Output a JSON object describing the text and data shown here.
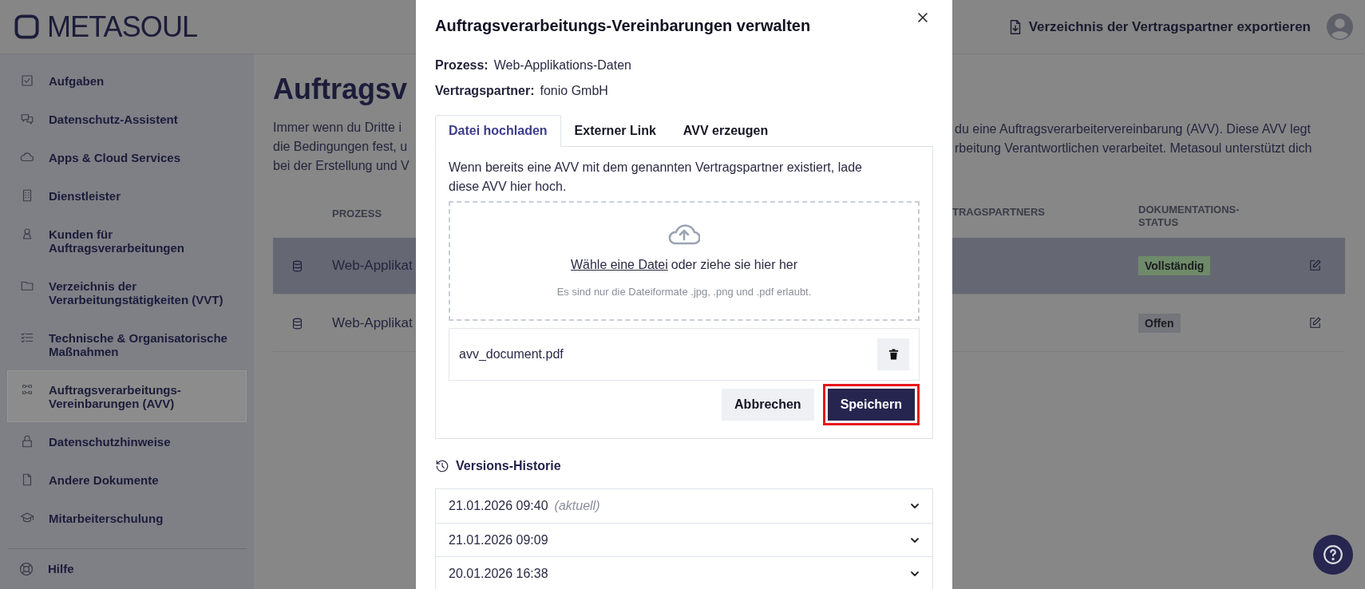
{
  "header": {
    "logo": "METASOUL",
    "export_button": "Verzeichnis der Vertragspartner exportieren"
  },
  "sidebar": {
    "items": [
      {
        "label": "Aufgaben",
        "selected": false
      },
      {
        "label": "Datenschutz-Assistent",
        "selected": false
      },
      {
        "label": "Apps & Cloud Services",
        "selected": false
      },
      {
        "label": "Dienstleister",
        "selected": false
      },
      {
        "label": "Kunden für Auftragsverarbeitungen",
        "selected": false
      },
      {
        "label": "Verzeichnis der Verarbeitungstätigkeiten (VVT)",
        "selected": false
      },
      {
        "label": "Technische & Organisatorische Maßnahmen",
        "selected": false
      },
      {
        "label": "Auftragsverarbeitungs-Vereinbarungen (AVV)",
        "selected": true
      },
      {
        "label": "Datenschutzhinweise",
        "selected": false
      },
      {
        "label": "Andere Dokumente",
        "selected": false
      },
      {
        "label": "Mitarbeiterschulung",
        "selected": false
      }
    ],
    "footer_items": [
      {
        "label": "Hilfe"
      }
    ]
  },
  "page": {
    "heading": "Auftragsv",
    "intro_left": [
      "Immer wenn du Dritte i",
      "die Bedingungen fest, u",
      "bei der Erstellung und V"
    ],
    "intro_right": [
      "du eine Auftragsverarbeitervereinbarung (AVV). Diese AVV legt",
      "rbeitung Verantwortlichen verarbeitet. Metasoul unterstützt dich"
    ],
    "table": {
      "columns_left": [
        "PROZESS"
      ],
      "columns_right": [
        "TRAGSPARTNERS",
        "DOKUMENTATIONS-STATUS"
      ],
      "rows": [
        {
          "process": "Web-Applikat",
          "status": "Vollständig",
          "color": "#6f8a6a",
          "selected": true
        },
        {
          "process": "Web-Applikat",
          "status": "Offen",
          "color": "#74767c",
          "selected": false
        }
      ]
    }
  },
  "dialog": {
    "title": "Auftragsverarbeitungs-Vereinbarungen verwalten",
    "fields": [
      {
        "label": "Prozess:",
        "value": "Web-Applikations-Daten"
      },
      {
        "label": "Vertragspartner:",
        "value": "fonio GmbH"
      }
    ],
    "tabs": [
      {
        "label": "Datei hochladen",
        "selected": true
      },
      {
        "label": "Externer Link",
        "selected": false
      },
      {
        "label": "AVV erzeugen",
        "selected": false
      }
    ],
    "upload": {
      "hint": "Wenn bereits eine AVV mit dem genannten Vertragspartner existiert, lade diese AVV hier hoch.",
      "choose_link": "Wähle eine Datei",
      "drop_text": "oder ziehe sie hier her",
      "formats": "Es sind nur die Dateiformate .jpg, .png und .pdf erlaubt.",
      "file": "avv_document.pdf"
    },
    "buttons": [
      {
        "label": "Abbrechen",
        "kind": "secondary",
        "highlighted": false
      },
      {
        "label": "Speichern",
        "kind": "primary",
        "highlighted": true
      }
    ],
    "history": {
      "title": "Versions-Historie",
      "versions": [
        {
          "date": "21.01.2026 09:40",
          "tag": "(aktuell)"
        },
        {
          "date": "21.01.2026 09:09"
        },
        {
          "date": "20.01.2026 16:38"
        }
      ]
    }
  }
}
